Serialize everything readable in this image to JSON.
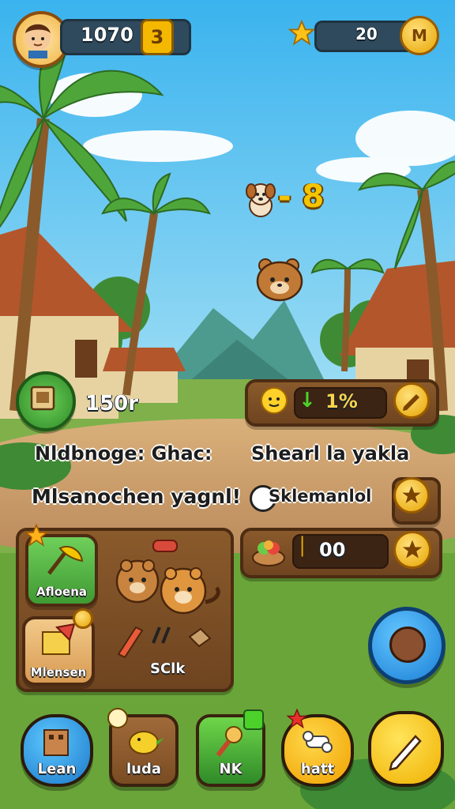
{
  "hud": {
    "score": "1070",
    "score_badge": "3",
    "stars": "20",
    "stars_badge": "M"
  },
  "center": {
    "equation_label": "- 8"
  },
  "left_panel": {
    "counter_value": "150r",
    "line1": "Nldbnoge: Ghac:",
    "line2": "Mlsanochen yagnl!"
  },
  "right_panel": {
    "progress_value": "1%",
    "title": "Shearl la yakla",
    "subtitle": "Sklemanlol",
    "count_value": "00"
  },
  "inventory": {
    "item1_label": "Afloena",
    "item2_label": "Mlensen",
    "item3_label": "SClk"
  },
  "nav": {
    "btn1_label": "Lean",
    "btn2_label": "luda",
    "btn3_label": "NK",
    "btn4_label": "hatt"
  },
  "colors": {
    "sky": "#67c9f2",
    "grass": "#6aa53a",
    "wood": "#7b4b22",
    "accent_gold": "#f5b800"
  }
}
